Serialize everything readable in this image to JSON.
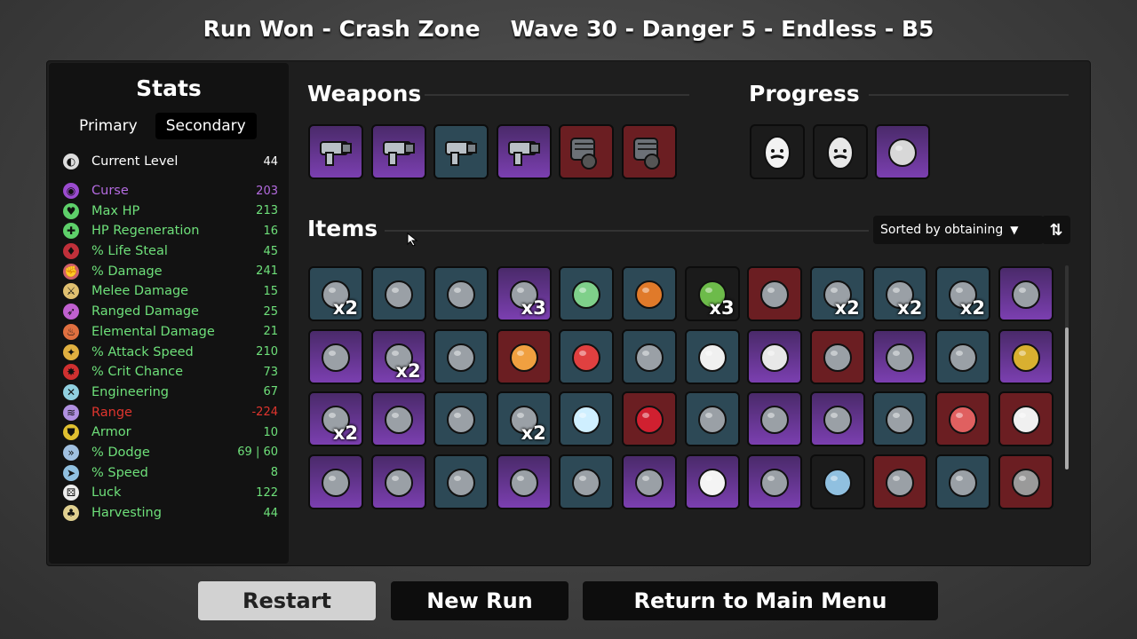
{
  "header": {
    "run_result": "Run Won - Crash Zone",
    "wave_info": "Wave 30 - Danger 5 - Endless - B5"
  },
  "stats": {
    "title": "Stats",
    "tabs": [
      {
        "label": "Primary",
        "active": false
      },
      {
        "label": "Secondary",
        "active": true
      }
    ],
    "rows": [
      {
        "icon": "level-icon",
        "label": "Current Level",
        "value": "44",
        "label_color": "#ffffff",
        "value_color": "#ffffff"
      },
      {
        "icon": "curse-icon",
        "label": "Curse",
        "value": "203",
        "label_color": "#b46be0",
        "value_color": "#b46be0"
      },
      {
        "icon": "heart-icon",
        "label": "Max HP",
        "value": "213",
        "label_color": "#6ee07a",
        "value_color": "#6ee07a"
      },
      {
        "icon": "hp-regen-icon",
        "label": "HP Regeneration",
        "value": "16",
        "label_color": "#6ee07a",
        "value_color": "#6ee07a"
      },
      {
        "icon": "life-steal-icon",
        "label": "% Life Steal",
        "value": "45",
        "label_color": "#6ee07a",
        "value_color": "#6ee07a"
      },
      {
        "icon": "damage-icon",
        "label": "% Damage",
        "value": "241",
        "label_color": "#6ee07a",
        "value_color": "#6ee07a"
      },
      {
        "icon": "sword-icon",
        "label": "Melee Damage",
        "value": "15",
        "label_color": "#6ee07a",
        "value_color": "#6ee07a"
      },
      {
        "icon": "bow-icon",
        "label": "Ranged Damage",
        "value": "25",
        "label_color": "#6ee07a",
        "value_color": "#6ee07a"
      },
      {
        "icon": "flame-icon",
        "label": "Elemental Damage",
        "value": "21",
        "label_color": "#6ee07a",
        "value_color": "#6ee07a"
      },
      {
        "icon": "attack-speed-icon",
        "label": "% Attack Speed",
        "value": "210",
        "label_color": "#6ee07a",
        "value_color": "#6ee07a"
      },
      {
        "icon": "crit-icon",
        "label": "% Crit Chance",
        "value": "73",
        "label_color": "#6ee07a",
        "value_color": "#6ee07a"
      },
      {
        "icon": "wrench-icon",
        "label": "Engineering",
        "value": "67",
        "label_color": "#6ee07a",
        "value_color": "#6ee07a"
      },
      {
        "icon": "range-icon",
        "label": "Range",
        "value": "-224",
        "label_color": "#e0352e",
        "value_color": "#e0352e"
      },
      {
        "icon": "shield-icon",
        "label": "Armor",
        "value": "10",
        "label_color": "#6ee07a",
        "value_color": "#6ee07a"
      },
      {
        "icon": "dodge-icon",
        "label": "% Dodge",
        "value": "69 | 60",
        "label_color": "#6ee07a",
        "value_color": "#6ee07a"
      },
      {
        "icon": "speed-icon",
        "label": "% Speed",
        "value": "8",
        "label_color": "#6ee07a",
        "value_color": "#6ee07a"
      },
      {
        "icon": "dice-icon",
        "label": "Luck",
        "value": "122",
        "label_color": "#6ee07a",
        "value_color": "#6ee07a"
      },
      {
        "icon": "harvest-icon",
        "label": "Harvesting",
        "value": "44",
        "label_color": "#6ee07a",
        "value_color": "#6ee07a"
      }
    ]
  },
  "weapons": {
    "title": "Weapons",
    "slots": [
      {
        "icon": "smg-icon",
        "tier": "purple"
      },
      {
        "icon": "smg-icon",
        "tier": "purple"
      },
      {
        "icon": "smg-icon",
        "tier": "blue"
      },
      {
        "icon": "smg-icon",
        "tier": "purple"
      },
      {
        "icon": "minigun-icon",
        "tier": "red"
      },
      {
        "icon": "minigun-icon",
        "tier": "red"
      }
    ]
  },
  "progress": {
    "title": "Progress",
    "slots": [
      {
        "icon": "mustache-egg-icon",
        "tier": "dark"
      },
      {
        "icon": "masked-egg-icon",
        "tier": "dark"
      },
      {
        "icon": "larva-icon",
        "tier": "purple"
      }
    ]
  },
  "items": {
    "title": "Items",
    "sort_label": "Sorted by obtaining",
    "grid": [
      {
        "icon": "bird-icon",
        "tier": "blue",
        "qty": "x2"
      },
      {
        "icon": "leech-icon",
        "tier": "blue",
        "qty": ""
      },
      {
        "icon": "flag-icon",
        "tier": "blue",
        "qty": ""
      },
      {
        "icon": "zombie-icon",
        "tier": "purple",
        "qty": "x3"
      },
      {
        "icon": "frog-icon",
        "tier": "blue",
        "qty": ""
      },
      {
        "icon": "pumpkin-icon",
        "tier": "blue",
        "qty": ""
      },
      {
        "icon": "tree-icon",
        "tier": "dark",
        "qty": "x3"
      },
      {
        "icon": "scroll-icon",
        "tier": "red",
        "qty": ""
      },
      {
        "icon": "needle-icon",
        "tier": "blue",
        "qty": "x2"
      },
      {
        "icon": "medic-icon",
        "tier": "blue",
        "qty": "x2"
      },
      {
        "icon": "belt-icon",
        "tier": "blue",
        "qty": "x2"
      },
      {
        "icon": "ghoul-icon",
        "tier": "purple",
        "qty": ""
      },
      {
        "icon": "mortar-icon",
        "tier": "purple",
        "qty": ""
      },
      {
        "icon": "crystal-icon",
        "tier": "purple",
        "qty": "x2"
      },
      {
        "icon": "crate-icon",
        "tier": "blue",
        "qty": ""
      },
      {
        "icon": "leaf-icon",
        "tier": "red",
        "qty": ""
      },
      {
        "icon": "coral-icon",
        "tier": "blue",
        "qty": ""
      },
      {
        "icon": "stone-icon",
        "tier": "blue",
        "qty": ""
      },
      {
        "icon": "penguin-icon",
        "tier": "blue",
        "qty": ""
      },
      {
        "icon": "statue-icon",
        "tier": "purple",
        "qty": ""
      },
      {
        "icon": "claw-mark-icon",
        "tier": "red",
        "qty": ""
      },
      {
        "icon": "turret-icon",
        "tier": "purple",
        "qty": ""
      },
      {
        "icon": "glasses-icon",
        "tier": "blue",
        "qty": ""
      },
      {
        "icon": "crown-icon",
        "tier": "purple",
        "qty": ""
      },
      {
        "icon": "tractor-icon",
        "tier": "purple",
        "qty": "x2"
      },
      {
        "icon": "monkey-icon",
        "tier": "purple",
        "qty": ""
      },
      {
        "icon": "black-belt-icon",
        "tier": "blue",
        "qty": ""
      },
      {
        "icon": "hat-icon",
        "tier": "blue",
        "qty": "x2"
      },
      {
        "icon": "ice-cube-icon",
        "tier": "blue",
        "qty": ""
      },
      {
        "icon": "vial-icon",
        "tier": "red",
        "qty": ""
      },
      {
        "icon": "white-flag-icon",
        "tier": "blue",
        "qty": ""
      },
      {
        "icon": "wings-icon",
        "tier": "purple",
        "qty": ""
      },
      {
        "icon": "chameleon-icon",
        "tier": "purple",
        "qty": ""
      },
      {
        "icon": "mosquito-icon",
        "tier": "blue",
        "qty": ""
      },
      {
        "icon": "stomach-icon",
        "tier": "red",
        "qty": ""
      },
      {
        "icon": "bloody-hand-icon",
        "tier": "red",
        "qty": ""
      },
      {
        "icon": "ring-icon",
        "tier": "purple",
        "qty": ""
      },
      {
        "icon": "turret-icon",
        "tier": "purple",
        "qty": ""
      },
      {
        "icon": "horns-icon",
        "tier": "blue",
        "qty": ""
      },
      {
        "icon": "worm-icon",
        "tier": "purple",
        "qty": ""
      },
      {
        "icon": "barrel-icon",
        "tier": "blue",
        "qty": ""
      },
      {
        "icon": "book-icon",
        "tier": "purple",
        "qty": ""
      },
      {
        "icon": "ghost-icon",
        "tier": "purple",
        "qty": ""
      },
      {
        "icon": "barrel-icon",
        "tier": "purple",
        "qty": ""
      },
      {
        "icon": "fish-icon",
        "tier": "dark",
        "qty": ""
      },
      {
        "icon": "robot-icon",
        "tier": "red",
        "qty": ""
      },
      {
        "icon": "armor-icon",
        "tier": "blue",
        "qty": ""
      },
      {
        "icon": "wolf-icon",
        "tier": "red",
        "qty": ""
      }
    ]
  },
  "buttons": {
    "restart": "Restart",
    "new_run": "New Run",
    "main_menu": "Return to Main Menu"
  }
}
